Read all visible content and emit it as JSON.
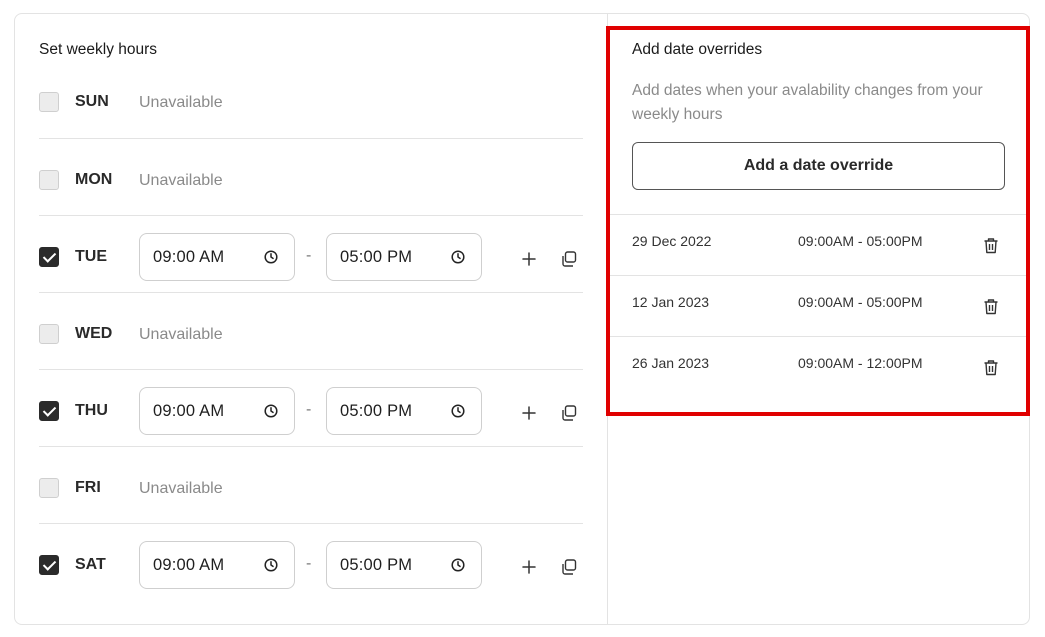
{
  "weekly": {
    "title": "Set weekly hours",
    "dash": "-",
    "days": [
      {
        "label": "SUN",
        "checked": false,
        "status": "Unavailable"
      },
      {
        "label": "MON",
        "checked": false,
        "status": "Unavailable"
      },
      {
        "label": "TUE",
        "checked": true,
        "start": "09:00 AM",
        "end": "05:00 PM"
      },
      {
        "label": "WED",
        "checked": false,
        "status": "Unavailable"
      },
      {
        "label": "THU",
        "checked": true,
        "start": "09:00 AM",
        "end": "05:00 PM"
      },
      {
        "label": "FRI",
        "checked": false,
        "status": "Unavailable"
      },
      {
        "label": "SAT",
        "checked": true,
        "start": "09:00 AM",
        "end": "05:00 PM"
      }
    ]
  },
  "overrides": {
    "title": "Add date overrides",
    "description": "Add dates when your avalability changes from your weekly hours",
    "add_button": "Add a date override",
    "items": [
      {
        "date": "29 Dec 2022",
        "time": "09:00AM - 05:00PM"
      },
      {
        "date": "12 Jan 2023",
        "time": "09:00AM - 05:00PM"
      },
      {
        "date": "26 Jan 2023",
        "time": "09:00AM - 12:00PM"
      }
    ]
  },
  "colors": {
    "highlight": "#e00000",
    "checkbox_on": "#2b2b2b",
    "muted_text": "#8a8a8a"
  },
  "icons": [
    "clock-icon",
    "plus-icon",
    "copy-icon",
    "trash-icon"
  ]
}
